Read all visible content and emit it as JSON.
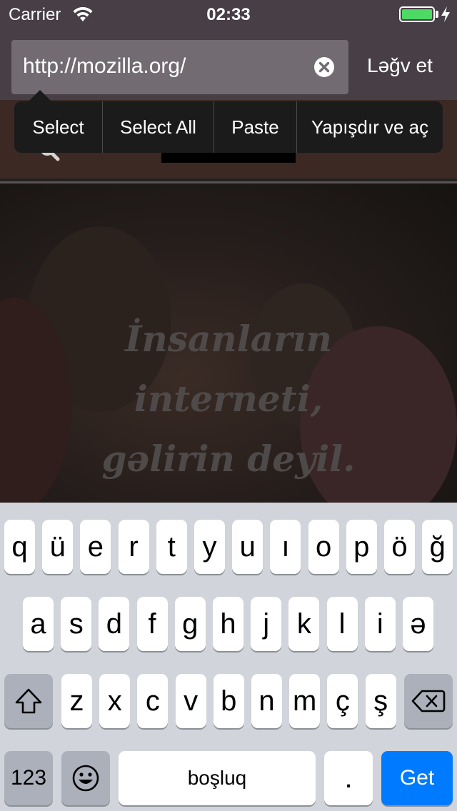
{
  "status_bar": {
    "carrier": "Carrier",
    "time": "02:33",
    "battery_level_percent": 100
  },
  "address_bar": {
    "url": "http://mozilla.org/",
    "cancel_label": "Ləğv et"
  },
  "edit_menu": {
    "items": [
      "Select",
      "Select All",
      "Paste",
      "Yapışdır ve aç"
    ]
  },
  "hero": {
    "lines": [
      "İnsanların",
      "interneti,",
      "gəlirin deyil."
    ]
  },
  "keyboard": {
    "row1": [
      "q",
      "ü",
      "e",
      "r",
      "t",
      "y",
      "u",
      "ı",
      "o",
      "p",
      "ö",
      "ğ"
    ],
    "row2": [
      "a",
      "s",
      "d",
      "f",
      "g",
      "h",
      "j",
      "k",
      "l",
      "i",
      "ə"
    ],
    "row3": [
      "z",
      "x",
      "c",
      "v",
      "b",
      "n",
      "m",
      "ç",
      "ş"
    ],
    "numbers_label": "123",
    "space_label": "boşluq",
    "period_label": ".",
    "go_label": "Get"
  },
  "colors": {
    "accent_go": "#007aff",
    "battery_green": "#4cd964"
  }
}
